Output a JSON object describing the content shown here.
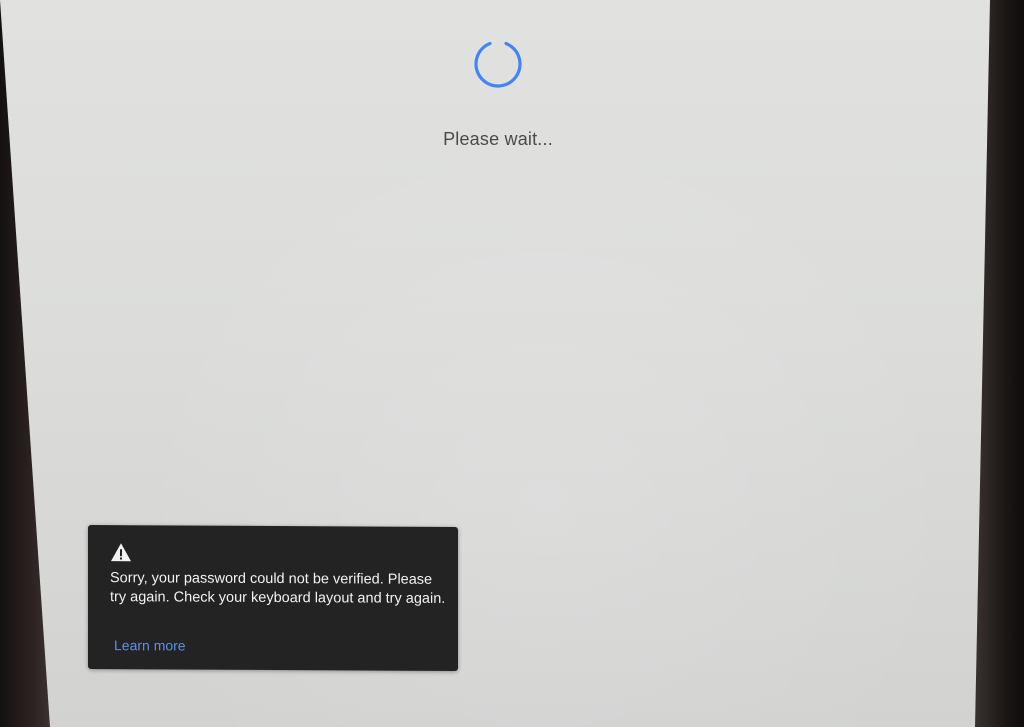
{
  "status": {
    "loading_text": "Please wait..."
  },
  "error": {
    "icon": "warning-icon",
    "message": "Sorry, your password could not be verified. Please try again. Check your keyboard layout and try again.",
    "link_label": "Learn more"
  },
  "colors": {
    "spinner": "#4285f4",
    "bubble_background": "#232323",
    "link": "#5a8fe6"
  }
}
